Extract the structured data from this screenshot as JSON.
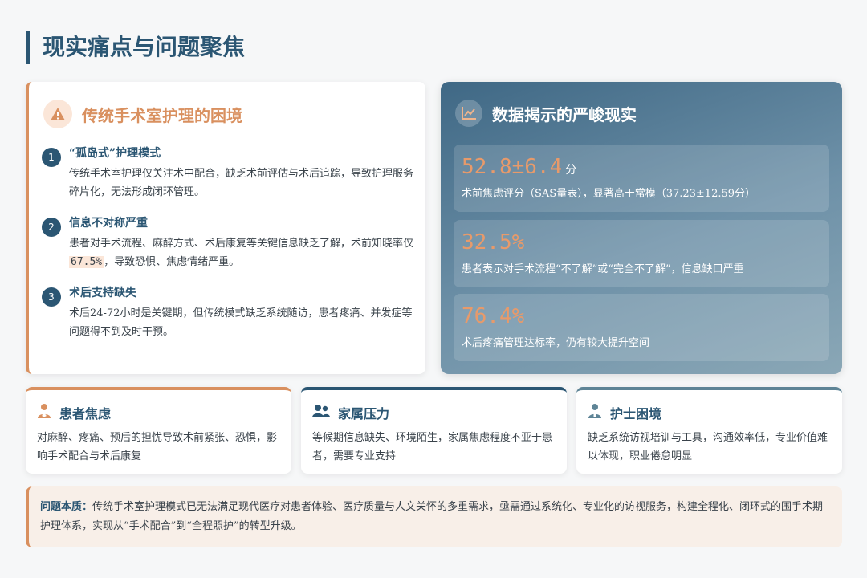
{
  "page": {
    "title": "现实痛点与问题聚焦"
  },
  "left": {
    "title": "传统手术室护理的困境",
    "items": [
      {
        "num": "1",
        "title": "“孤岛式”护理模式",
        "text": "传统手术室护理仅关注术中配合，缺乏术前评估与术后追踪，导致护理服务碎片化，无法形成闭环管理。"
      },
      {
        "num": "2",
        "title": "信息不对称严重",
        "text_a": "患者对手术流程、麻醉方式、术后康复等关键信息缺乏了解，术前知晓率仅",
        "highlight": "67.5%",
        "text_b": "，导致恐惧、焦虑情绪严重。"
      },
      {
        "num": "3",
        "title": "术后支持缺失",
        "text": "术后24-72小时是关键期，但传统模式缺乏系统随访，患者疼痛、并发症等问题得不到及时干预。"
      }
    ]
  },
  "right": {
    "title": "数据揭示的严峻现实",
    "stats": [
      {
        "value": "52.8±6.4",
        "unit": "分",
        "desc": "术前焦虑评分（SAS量表），显著高于常模（37.23±12.59分）"
      },
      {
        "value": "32.5%",
        "unit": "",
        "desc": "患者表示对手术流程“不了解”或“完全不了解”，信息缺口严重"
      },
      {
        "value": "76.4%",
        "unit": "",
        "desc": "术后疼痛管理达标率，仍有较大提升空间"
      }
    ]
  },
  "cards": [
    {
      "title": "患者焦虑",
      "text": "对麻醉、疼痛、预后的担忧导致术前紧张、恐惧，影响手术配合与术后康复",
      "color": "#d9905f"
    },
    {
      "title": "家属压力",
      "text": "等候期信息缺失、环境陌生，家属焦虑程度不亚于患者，需要专业支持",
      "color": "#2b5673"
    },
    {
      "title": "护士困境",
      "text": "缺乏系统访视培训与工具，沟通效率低，专业价值难以体现，职业倦怠明显",
      "color": "#5e8496"
    }
  ],
  "note": {
    "label": "问题本质：",
    "text": "传统手术室护理模式已无法满足现代医疗对患者体验、医疗质量与人文关怀的多重需求，亟需通过系统化、专业化的访视服务，构建全程化、闭环式的围手术期护理体系，实现从“手术配合”到“全程照护”的转型升级。"
  }
}
